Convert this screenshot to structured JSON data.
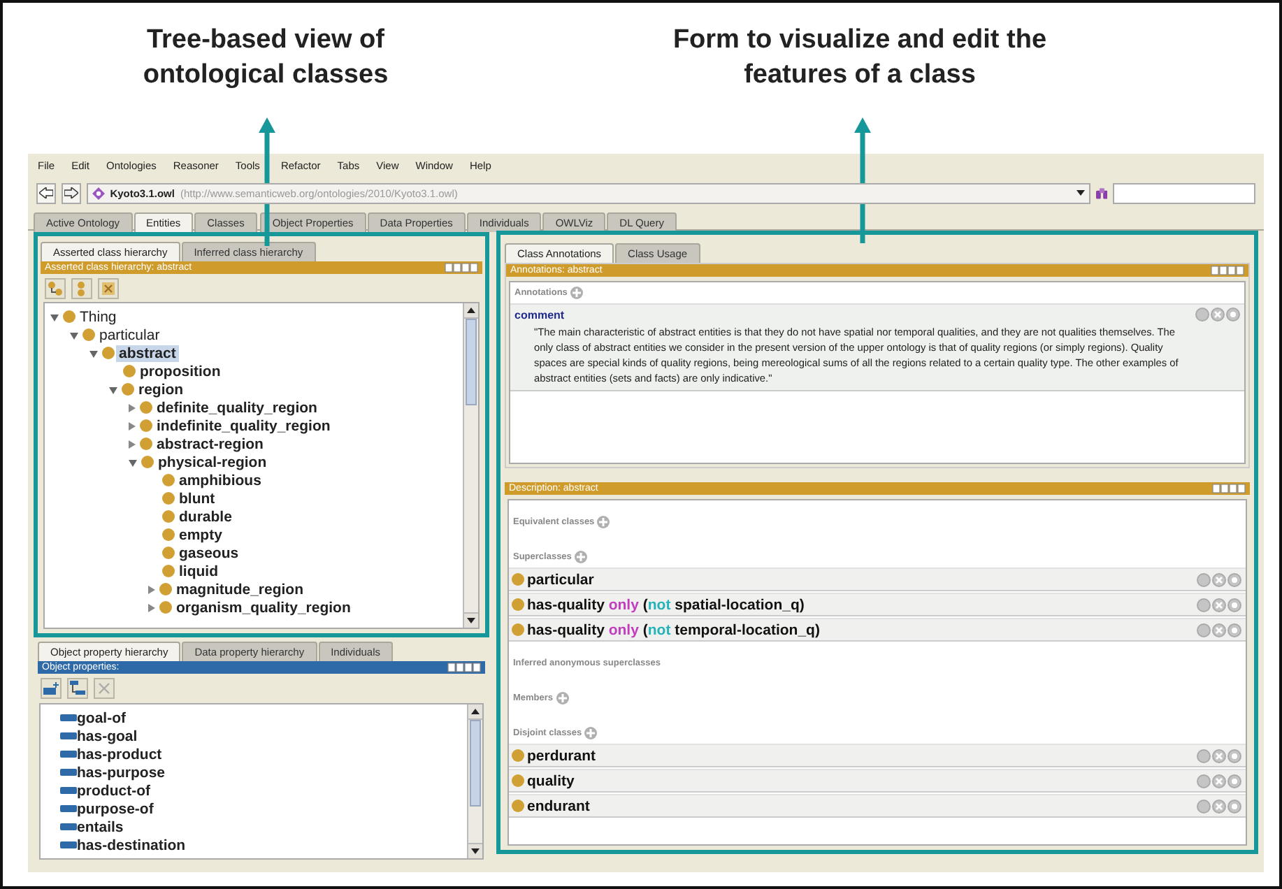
{
  "captions": [
    {
      "text": "Tree-based view of ontological classes"
    },
    {
      "text": "Form to visualize and edit the features of a class"
    }
  ],
  "menu": [
    "File",
    "Edit",
    "Ontologies",
    "Reasoner",
    "Tools",
    "Refactor",
    "Tabs",
    "View",
    "Window",
    "Help"
  ],
  "toolbar": {
    "ontology_name": "Kyoto3.1.owl",
    "ontology_uri": "(http://www.semanticweb.org/ontologies/2010/Kyoto3.1.owl)"
  },
  "tabs": [
    {
      "label": "Active Ontology",
      "selected": false
    },
    {
      "label": "Entities",
      "selected": true
    },
    {
      "label": "Classes",
      "selected": false
    },
    {
      "label": "Object Properties",
      "selected": false
    },
    {
      "label": "Data Properties",
      "selected": false
    },
    {
      "label": "Individuals",
      "selected": false
    },
    {
      "label": "OWLViz",
      "selected": false
    },
    {
      "label": "DL Query",
      "selected": false
    }
  ],
  "class_panel": {
    "tabs": [
      {
        "label": "Asserted class hierarchy",
        "selected": true
      },
      {
        "label": "Inferred class hierarchy",
        "selected": false
      }
    ],
    "header": "Asserted class hierarchy: abstract",
    "tree": [
      {
        "label": "Thing",
        "expanded": true,
        "selected": false,
        "emphasized": false,
        "children": [
          {
            "label": "particular",
            "expanded": true,
            "selected": false,
            "emphasized": false,
            "children": [
              {
                "label": "abstract",
                "expanded": true,
                "selected": true,
                "emphasized": true,
                "children": [
                  {
                    "label": "proposition",
                    "selected": false,
                    "emphasized": true
                  },
                  {
                    "label": "region",
                    "expanded": true,
                    "selected": false,
                    "emphasized": true,
                    "children": [
                      {
                        "label": "definite_quality_region",
                        "expanded": false,
                        "selected": false,
                        "emphasized": true
                      },
                      {
                        "label": "indefinite_quality_region",
                        "expanded": false,
                        "selected": false,
                        "emphasized": true
                      },
                      {
                        "label": "abstract-region",
                        "expanded": false,
                        "selected": false,
                        "emphasized": true
                      },
                      {
                        "label": "physical-region",
                        "expanded": true,
                        "selected": false,
                        "emphasized": true,
                        "children": [
                          {
                            "label": "amphibious",
                            "selected": false,
                            "emphasized": true
                          },
                          {
                            "label": "blunt",
                            "selected": false,
                            "emphasized": true
                          },
                          {
                            "label": "durable",
                            "selected": false,
                            "emphasized": true
                          },
                          {
                            "label": "empty",
                            "selected": false,
                            "emphasized": true
                          },
                          {
                            "label": "gaseous",
                            "selected": false,
                            "emphasized": true
                          },
                          {
                            "label": "liquid",
                            "selected": false,
                            "emphasized": true
                          },
                          {
                            "label": "magnitude_region",
                            "expanded": false,
                            "selected": false,
                            "emphasized": true
                          },
                          {
                            "label": "organism_quality_region",
                            "expanded": false,
                            "selected": false,
                            "emphasized": true
                          }
                        ]
                      }
                    ]
                  }
                ]
              }
            ]
          }
        ]
      }
    ]
  },
  "property_panel": {
    "tabs": [
      {
        "label": "Object property hierarchy",
        "selected": true
      },
      {
        "label": "Data property hierarchy",
        "selected": false
      },
      {
        "label": "Individuals",
        "selected": false
      }
    ],
    "header": "Object properties:",
    "items": [
      "goal-of",
      "has-goal",
      "has-product",
      "has-purpose",
      "product-of",
      "purpose-of",
      "entails",
      "has-destination"
    ]
  },
  "class_form": {
    "tabs": [
      {
        "label": "Class Annotations",
        "selected": true
      },
      {
        "label": "Class Usage",
        "selected": false
      }
    ],
    "annotations_header": "Annotations: abstract",
    "annotations_title": "Annotations",
    "annotation": {
      "property": "comment",
      "value": "\"The main characteristic of abstract entities is that  they do not have spatial nor temporal qualities, and they are not qualities themselves.  The only class of abstract entities we consider in the present version of the upper  ontology is that of quality regions (or simply regions). Quality spaces are special  kinds of quality regions, being mereological sums of all the regions related to a certain quality type. The other examples of abstract entities (sets and facts) are only  indicative.\""
    },
    "description_header": "Description: abstract",
    "sections": [
      {
        "title": "Equivalent classes",
        "addable": true
      },
      {
        "title": "Superclasses",
        "addable": true,
        "items": [
          [
            {
              "text": "particular",
              "kind": "name"
            }
          ],
          [
            {
              "text": "has-quality ",
              "kind": "name"
            },
            {
              "text": "only",
              "kind": "restriction"
            },
            {
              "text": " (",
              "kind": "name"
            },
            {
              "text": "not",
              "kind": "negation"
            },
            {
              "text": " spatial-location_q)",
              "kind": "name"
            }
          ],
          [
            {
              "text": "has-quality ",
              "kind": "name"
            },
            {
              "text": "only",
              "kind": "restriction"
            },
            {
              "text": " (",
              "kind": "name"
            },
            {
              "text": "not",
              "kind": "negation"
            },
            {
              "text": " temporal-location_q)",
              "kind": "name"
            }
          ]
        ]
      },
      {
        "title": "Inferred anonymous superclasses",
        "addable": false
      },
      {
        "title": "Members",
        "addable": true
      },
      {
        "title": "Disjoint classes",
        "addable": true,
        "items": [
          [
            {
              "text": "perdurant",
              "kind": "name"
            }
          ],
          [
            {
              "text": "quality",
              "kind": "name"
            }
          ],
          [
            {
              "text": "endurant",
              "kind": "name"
            }
          ]
        ]
      }
    ]
  }
}
